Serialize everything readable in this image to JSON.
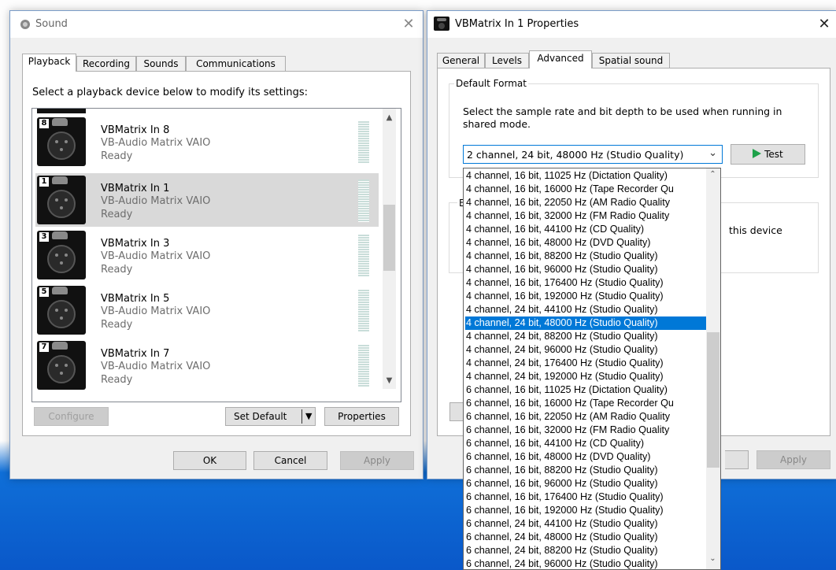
{
  "sound_dialog": {
    "title": "Sound",
    "close_glyph": "✕",
    "tabs": [
      "Playback",
      "Recording",
      "Sounds",
      "Communications"
    ],
    "instruction": "Select a playback device below to modify its settings:",
    "devices": [
      {
        "number": "8",
        "name": "VBMatrix In 8",
        "desc": "VB-Audio Matrix VAIO",
        "status": "Ready",
        "selected": false
      },
      {
        "number": "1",
        "name": "VBMatrix In 1",
        "desc": "VB-Audio Matrix VAIO",
        "status": "Ready",
        "selected": true
      },
      {
        "number": "3",
        "name": "VBMatrix In 3",
        "desc": "VB-Audio Matrix VAIO",
        "status": "Ready",
        "selected": false
      },
      {
        "number": "5",
        "name": "VBMatrix In 5",
        "desc": "VB-Audio Matrix VAIO",
        "status": "Ready",
        "selected": false
      },
      {
        "number": "7",
        "name": "VBMatrix In 7",
        "desc": "VB-Audio Matrix VAIO",
        "status": "Ready",
        "selected": false
      }
    ],
    "buttons": {
      "configure": "Configure",
      "set_default": "Set Default",
      "properties": "Properties",
      "ok": "OK",
      "cancel": "Cancel",
      "apply": "Apply"
    }
  },
  "props_dialog": {
    "title": "VBMatrix In 1 Properties",
    "close_glyph": "✕",
    "tabs": [
      "General",
      "Levels",
      "Advanced",
      "Spatial sound"
    ],
    "group_title": "Default Format",
    "group_desc": "Select the sample rate and bit depth to be used when running in shared mode.",
    "format_selected": "2 channel, 24 bit, 48000 Hz (Studio Quality)",
    "test_label": "Test",
    "hidden_text_fragment": "this device",
    "partial_letter": "E",
    "apply": "Apply",
    "format_options": [
      "4 channel, 16 bit, 11025 Hz (Dictation Quality)",
      "4 channel, 16 bit, 16000 Hz (Tape Recorder Qu",
      "4 channel, 16 bit, 22050 Hz (AM Radio Quality",
      "4 channel, 16 bit, 32000 Hz (FM Radio Quality",
      "4 channel, 16 bit, 44100 Hz (CD Quality)",
      "4 channel, 16 bit, 48000 Hz (DVD Quality)",
      "4 channel, 16 bit, 88200 Hz (Studio Quality)",
      "4 channel, 16 bit, 96000 Hz (Studio Quality)",
      "4 channel, 16 bit, 176400 Hz (Studio Quality)",
      "4 channel, 16 bit, 192000 Hz (Studio Quality)",
      "4 channel, 24 bit, 44100 Hz (Studio Quality)",
      "4 channel, 24 bit, 48000 Hz (Studio Quality)",
      "4 channel, 24 bit, 88200 Hz (Studio Quality)",
      "4 channel, 24 bit, 96000 Hz (Studio Quality)",
      "4 channel, 24 bit, 176400 Hz (Studio Quality)",
      "4 channel, 24 bit, 192000 Hz (Studio Quality)",
      "6 channel, 16 bit, 11025 Hz (Dictation Quality)",
      "6 channel, 16 bit, 16000 Hz (Tape Recorder Qu",
      "6 channel, 16 bit, 22050 Hz (AM Radio Quality",
      "6 channel, 16 bit, 32000 Hz (FM Radio Quality",
      "6 channel, 16 bit, 44100 Hz (CD Quality)",
      "6 channel, 16 bit, 48000 Hz (DVD Quality)",
      "6 channel, 16 bit, 88200 Hz (Studio Quality)",
      "6 channel, 16 bit, 96000 Hz (Studio Quality)",
      "6 channel, 16 bit, 176400 Hz (Studio Quality)",
      "6 channel, 16 bit, 192000 Hz (Studio Quality)",
      "6 channel, 24 bit, 44100 Hz (Studio Quality)",
      "6 channel, 24 bit, 48000 Hz (Studio Quality)",
      "6 channel, 24 bit, 88200 Hz (Studio Quality)",
      "6 channel, 24 bit, 96000 Hz (Studio Quality)"
    ],
    "highlighted_option": "4 channel, 24 bit, 48000 Hz (Studio Quality)"
  },
  "colors": {
    "selection": "#0078d7",
    "test_arrow": "#1ea14a",
    "desktop_blue": "#0a58c9"
  }
}
